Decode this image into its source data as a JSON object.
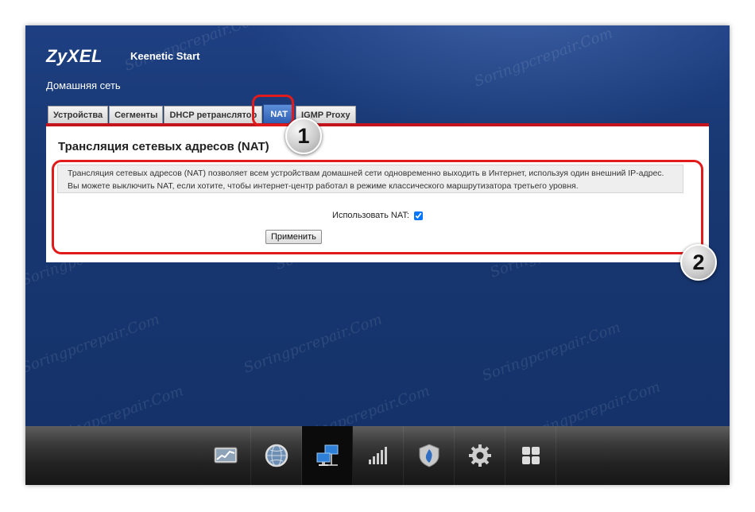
{
  "brand": {
    "logo": "ZyXEL",
    "model": "Keenetic Start"
  },
  "section_title": "Домашняя сеть",
  "tabs": [
    {
      "label": "Устройства",
      "active": false
    },
    {
      "label": "Сегменты",
      "active": false
    },
    {
      "label": "DHCP ретранслятор",
      "active": false
    },
    {
      "label": "NAT",
      "active": true
    },
    {
      "label": "IGMP Proxy",
      "active": false
    }
  ],
  "panel": {
    "title": "Трансляция сетевых адресов (NAT)",
    "description": "Трансляция сетевых адресов (NAT) позволяет всем устройствам домашней сети одновременно выходить в Интернет, используя один внешний IP-адрес. Вы можете выключить NAT, если хотите, чтобы интернет-центр работал в режиме классического маршрутизатора третьего уровня.",
    "nat_label": "Использовать NAT:",
    "nat_checked": true,
    "apply_label": "Применить"
  },
  "callouts": [
    {
      "number": "1"
    },
    {
      "number": "2"
    }
  ],
  "watermark_text": "Soringpcrepair.Com",
  "taskbar": {
    "items": [
      {
        "icon": "monitor-chart-icon",
        "active": false
      },
      {
        "icon": "globe-icon",
        "active": false
      },
      {
        "icon": "network-computers-icon",
        "active": true
      },
      {
        "icon": "signal-bars-icon",
        "active": false
      },
      {
        "icon": "shield-icon",
        "active": false
      },
      {
        "icon": "gear-icon",
        "active": false
      },
      {
        "icon": "apps-grid-icon",
        "active": false
      }
    ]
  },
  "colors": {
    "background": "#17356e",
    "accent_red": "#e11b1b",
    "tab_active": "#2e5fb3"
  }
}
